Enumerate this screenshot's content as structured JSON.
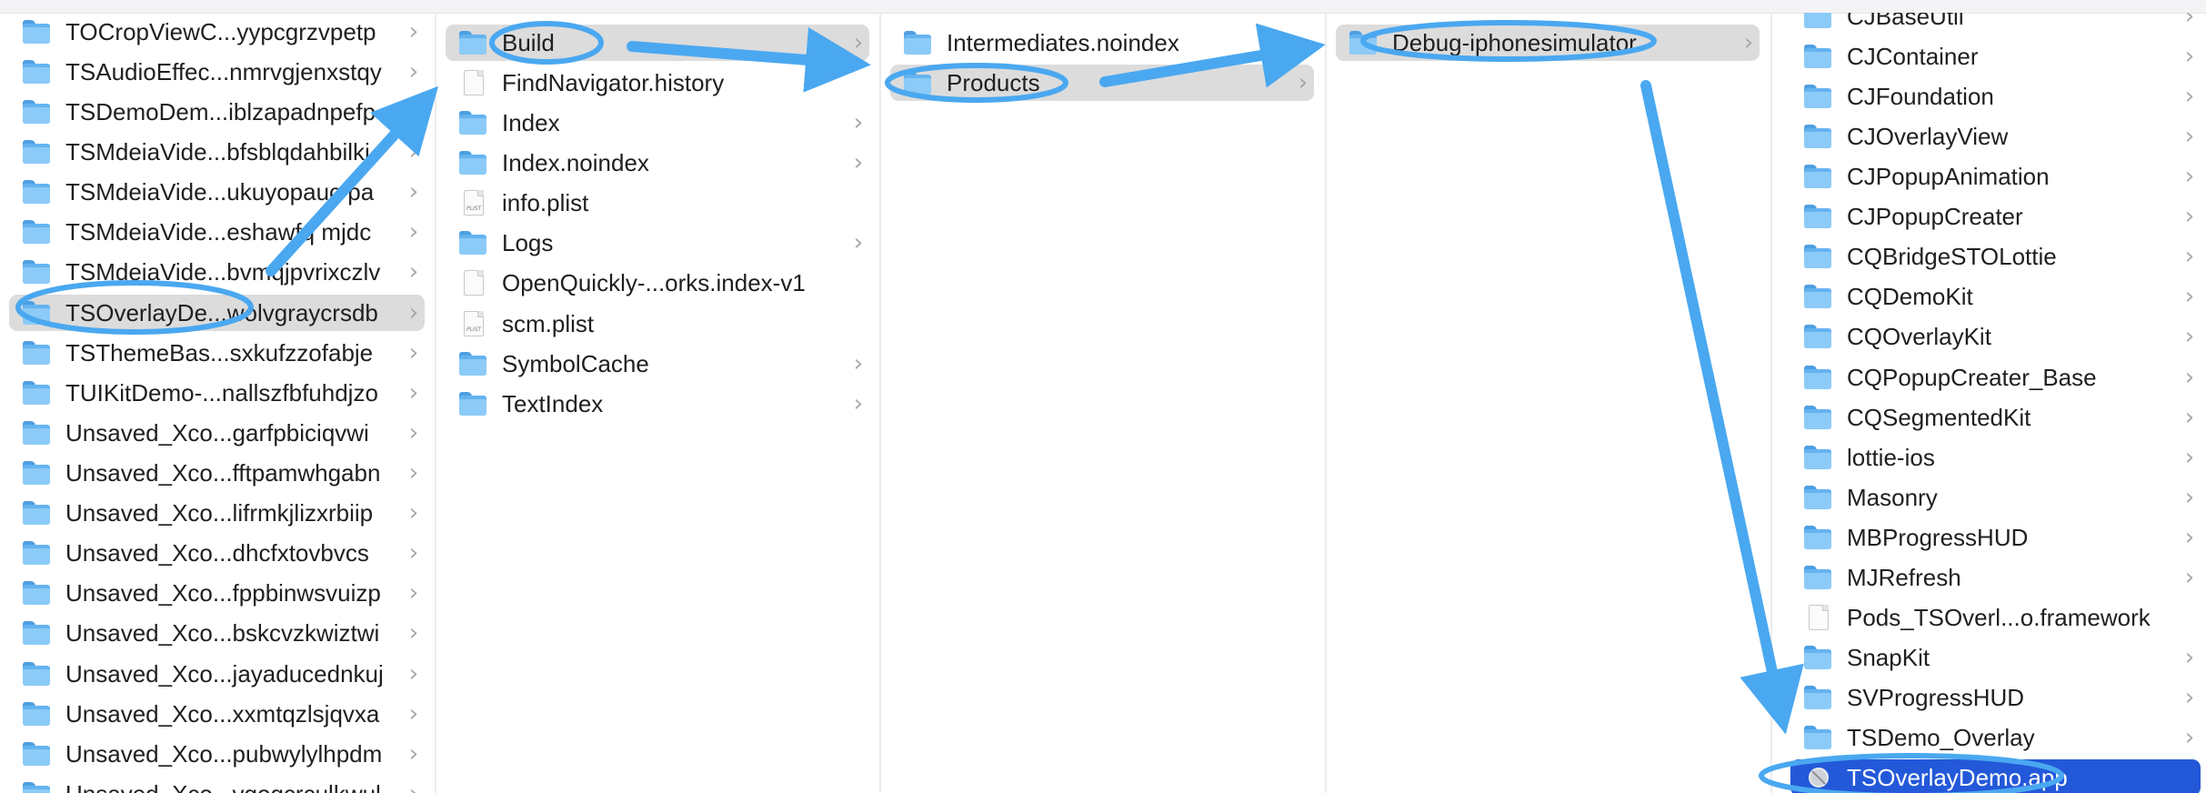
{
  "colors": {
    "annotation": "#4aa8f0",
    "selection_gray": "#dcdcdc",
    "selection_blue": "#2358d9",
    "folder": "#64b3f0"
  },
  "columns": [
    {
      "items": [
        {
          "label": "TOCropViewC...yypcgrzvpetp",
          "icon": "folder-icon",
          "chevron": true
        },
        {
          "label": "TSAudioEffec...nmrvgjenxstqy",
          "icon": "folder-icon",
          "chevron": true
        },
        {
          "label": "TSDemoDem...iblzapadnpefp",
          "icon": "folder-icon",
          "chevron": true
        },
        {
          "label": "TSMdeiaVide...bfsblqdahbilki",
          "icon": "folder-icon",
          "chevron": true
        },
        {
          "label": "TSMdeiaVide...ukuyopauc pa",
          "icon": "folder-icon",
          "chevron": true
        },
        {
          "label": "TSMdeiaVide...eshawfq mjdc",
          "icon": "folder-icon",
          "chevron": true
        },
        {
          "label": "TSMdeiaVide...bvmqjpvrixczlv",
          "icon": "folder-icon",
          "chevron": true
        },
        {
          "label": "TSOverlayDe...wolvgraycrsdb",
          "icon": "folder-icon",
          "chevron": true,
          "selected": "gray"
        },
        {
          "label": "TSThemeBas...sxkufzzofabje",
          "icon": "folder-icon",
          "chevron": true
        },
        {
          "label": "TUIKitDemo-...nallszfbfuhdjzo",
          "icon": "folder-icon",
          "chevron": true
        },
        {
          "label": "Unsaved_Xco...garfpbiciqvwi",
          "icon": "folder-icon",
          "chevron": true
        },
        {
          "label": "Unsaved_Xco...fftpamwhgabn",
          "icon": "folder-icon",
          "chevron": true
        },
        {
          "label": "Unsaved_Xco...lifrmkjlizxrbiip",
          "icon": "folder-icon",
          "chevron": true
        },
        {
          "label": "Unsaved_Xco...dhcfxtovbvcs",
          "icon": "folder-icon",
          "chevron": true
        },
        {
          "label": "Unsaved_Xco...fppbinwsvuizp",
          "icon": "folder-icon",
          "chevron": true
        },
        {
          "label": "Unsaved_Xco...bskcvzkwiztwi",
          "icon": "folder-icon",
          "chevron": true
        },
        {
          "label": "Unsaved_Xco...jayaducednkuj",
          "icon": "folder-icon",
          "chevron": true
        },
        {
          "label": "Unsaved_Xco...xxmtqzlsjqvxa",
          "icon": "folder-icon",
          "chevron": true
        },
        {
          "label": "Unsaved_Xco...pubwylylhpdm",
          "icon": "folder-icon",
          "chevron": true
        },
        {
          "label": "Unsaved_Xco...vgogcrculkwul",
          "icon": "folder-icon",
          "chevron": true
        }
      ]
    },
    {
      "items": [
        {
          "label": "Build",
          "icon": "folder-icon",
          "chevron": true,
          "selected": "gray"
        },
        {
          "label": "FindNavigator.history",
          "icon": "file-icon",
          "chevron": false
        },
        {
          "label": "Index",
          "icon": "folder-icon",
          "chevron": true
        },
        {
          "label": "Index.noindex",
          "icon": "folder-icon",
          "chevron": true
        },
        {
          "label": "info.plist",
          "icon": "plist-icon",
          "chevron": false
        },
        {
          "label": "Logs",
          "icon": "folder-icon",
          "chevron": true
        },
        {
          "label": "OpenQuickly-...orks.index-v1",
          "icon": "file-icon",
          "chevron": false
        },
        {
          "label": "scm.plist",
          "icon": "plist-icon",
          "chevron": false
        },
        {
          "label": "SymbolCache",
          "icon": "folder-icon",
          "chevron": true
        },
        {
          "label": "TextIndex",
          "icon": "folder-icon",
          "chevron": true
        }
      ]
    },
    {
      "items": [
        {
          "label": "Intermediates.noindex",
          "icon": "folder-icon",
          "chevron": false
        },
        {
          "label": "Products",
          "icon": "folder-icon",
          "chevron": true,
          "selected": "gray"
        }
      ]
    },
    {
      "items": [
        {
          "label": "Debug-iphonesimulator",
          "icon": "folder-icon",
          "chevron": true,
          "selected": "gray"
        }
      ]
    },
    {
      "items": [
        {
          "label": "CJBaseUtil",
          "icon": "folder-icon",
          "chevron": true
        },
        {
          "label": "CJContainer",
          "icon": "folder-icon",
          "chevron": true
        },
        {
          "label": "CJFoundation",
          "icon": "folder-icon",
          "chevron": true
        },
        {
          "label": "CJOverlayView",
          "icon": "folder-icon",
          "chevron": true
        },
        {
          "label": "CJPopupAnimation",
          "icon": "folder-icon",
          "chevron": true
        },
        {
          "label": "CJPopupCreater",
          "icon": "folder-icon",
          "chevron": true
        },
        {
          "label": "CQBridgeSTOLottie",
          "icon": "folder-icon",
          "chevron": true
        },
        {
          "label": "CQDemoKit",
          "icon": "folder-icon",
          "chevron": true
        },
        {
          "label": "CQOverlayKit",
          "icon": "folder-icon",
          "chevron": true
        },
        {
          "label": "CQPopupCreater_Base",
          "icon": "folder-icon",
          "chevron": true
        },
        {
          "label": "CQSegmentedKit",
          "icon": "folder-icon",
          "chevron": true
        },
        {
          "label": "lottie-ios",
          "icon": "folder-icon",
          "chevron": true
        },
        {
          "label": "Masonry",
          "icon": "folder-icon",
          "chevron": true
        },
        {
          "label": "MBProgressHUD",
          "icon": "folder-icon",
          "chevron": true
        },
        {
          "label": "MJRefresh",
          "icon": "folder-icon",
          "chevron": true
        },
        {
          "label": "Pods_TSOverl...o.framework",
          "icon": "file-icon",
          "chevron": false
        },
        {
          "label": "SnapKit",
          "icon": "folder-icon",
          "chevron": true
        },
        {
          "label": "SVProgressHUD",
          "icon": "folder-icon",
          "chevron": true
        },
        {
          "label": "TSDemo_Overlay",
          "icon": "folder-icon",
          "chevron": true
        },
        {
          "label": "TSOverlayDemo.app",
          "icon": "app-icon",
          "chevron": false,
          "selected": "blue"
        }
      ]
    }
  ]
}
